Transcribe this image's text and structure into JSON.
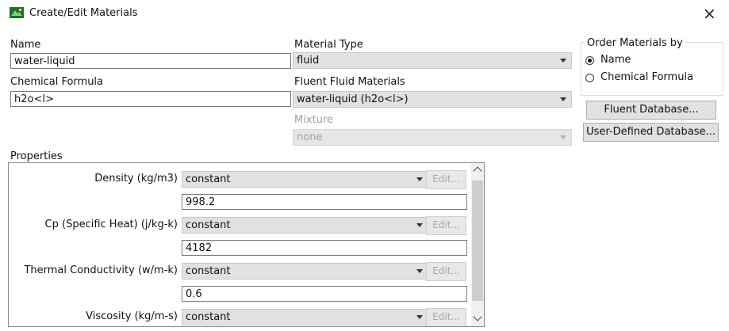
{
  "window": {
    "title": "Create/Edit Materials",
    "close_glyph": "×",
    "icon": "ansys-fluent-app-icon"
  },
  "name": {
    "label": "Name",
    "value": "water-liquid"
  },
  "chemical_formula": {
    "label": "Chemical Formula",
    "value": "h2o<l>"
  },
  "material_type": {
    "label": "Material Type",
    "value": "fluid"
  },
  "fluent_fluid_materials": {
    "label": "Fluent Fluid Materials",
    "value": "water-liquid (h2o<l>)"
  },
  "mixture": {
    "label": "Mixture",
    "value": "none",
    "enabled": false
  },
  "order_by": {
    "label": "Order Materials by",
    "options": [
      {
        "label": "Name",
        "selected": true
      },
      {
        "label": "Chemical Formula",
        "selected": false
      }
    ]
  },
  "buttons": {
    "fluent_database": "Fluent Database...",
    "user_defined_database": "User-Defined Database..."
  },
  "properties": {
    "label": "Properties",
    "edit_label": "Edit...",
    "rows": [
      {
        "label": "Density (kg/m3)",
        "method": "constant",
        "value": "998.2"
      },
      {
        "label": "Cp (Specific Heat) (j/kg-k)",
        "method": "constant",
        "value": "4182"
      },
      {
        "label": "Thermal Conductivity (w/m-k)",
        "method": "constant",
        "value": "0.6"
      },
      {
        "label": "Viscosity (kg/m-s)",
        "method": "constant",
        "value": ""
      }
    ]
  },
  "colors": {
    "accent_icon_green": "#2e8b3a",
    "window_bg": "#ffffff",
    "combo_bg": "#e1e1e1"
  }
}
